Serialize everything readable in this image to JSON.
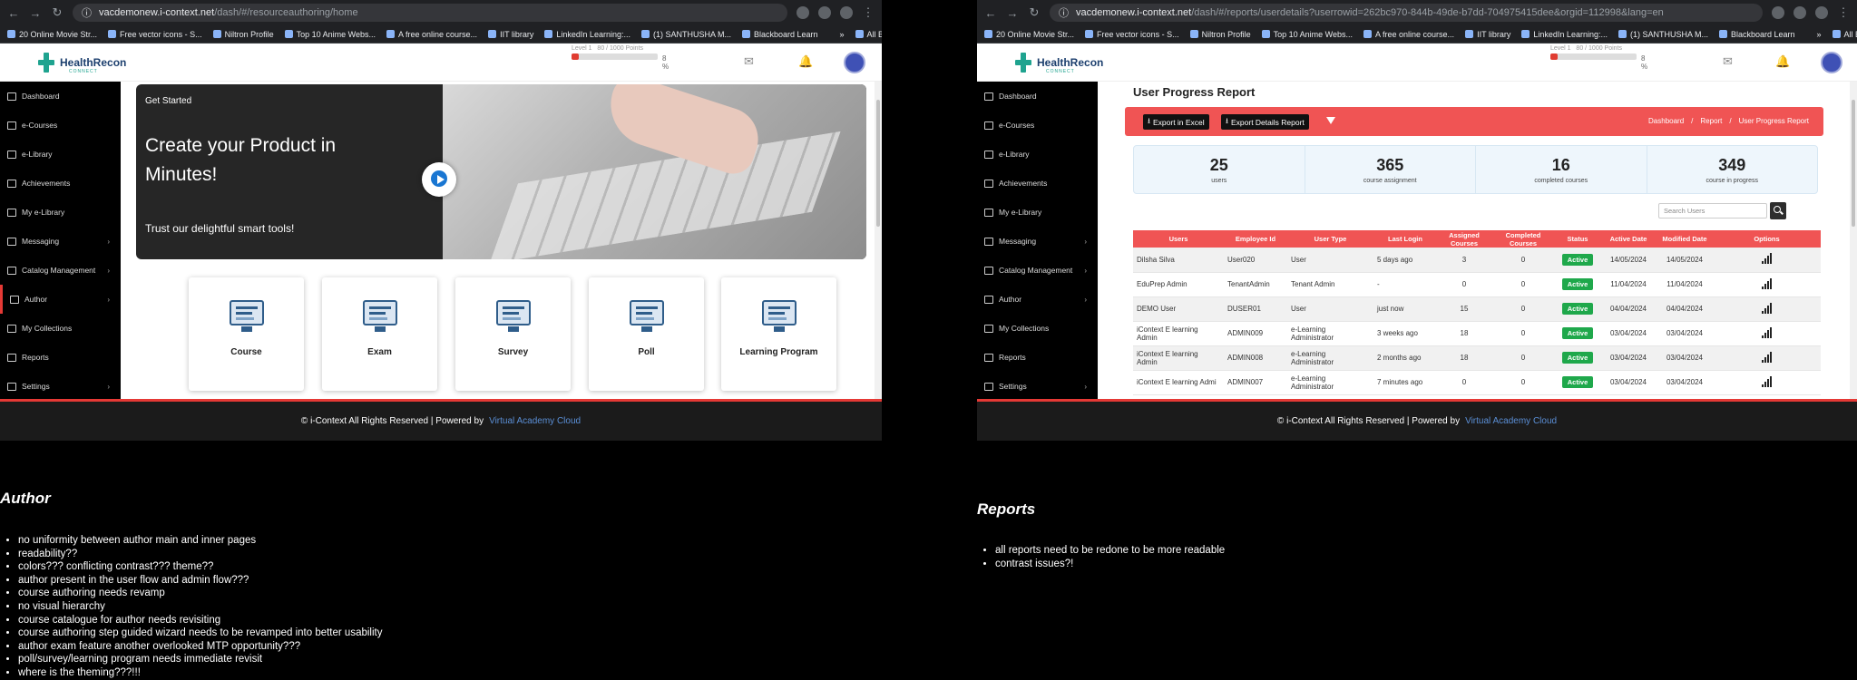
{
  "left": {
    "url_host": "vacdemonew.i-context.net",
    "url_path": "/dash/#/resourceauthoring/home",
    "bookmarks": [
      "20 Online Movie Str...",
      "Free vector icons - S...",
      "Niltron Profile",
      "Top 10 Anime Webs...",
      "A free online course...",
      "IIT library",
      "LinkedIn Learning:...",
      "(1) SANTHUSHA M...",
      "Blackboard Learn",
      "All Bookmarks"
    ],
    "logo": "HealthRecon",
    "logo_sub": "CONNECT",
    "level_label": "Level 1",
    "points_label": "80 / 1000 Points",
    "level_progress_pct": 8,
    "level_pct_text": "8 %",
    "sidebar": [
      "Dashboard",
      "e-Courses",
      "e-Library",
      "Achievements",
      "My e-Library",
      "Messaging",
      "Catalog Management",
      "Author",
      "My Collections",
      "Reports",
      "Settings"
    ],
    "hero": {
      "tag": "Get Started",
      "title": "Create your Product in Minutes!",
      "subtitle": "Trust our delightful smart tools!"
    },
    "cards": [
      "Course",
      "Exam",
      "Survey",
      "Poll",
      "Learning Program"
    ],
    "footer_text": "© i-Context All Rights Reserved | Powered by",
    "footer_link": "Virtual Academy Cloud"
  },
  "right": {
    "url_host": "vacdemonew.i-context.net",
    "url_path": "/dash/#/reports/userdetails?userrowid=262bc970-844b-49de-b7dd-704975415dee&orgid=112998&lang=en",
    "bookmarks": [
      "20 Online Movie Str...",
      "Free vector icons - S...",
      "Niltron Profile",
      "Top 10 Anime Webs...",
      "A free online course...",
      "IIT library",
      "LinkedIn Learning:...",
      "(1) SANTHUSHA M...",
      "Blackboard Learn",
      "All Bookmarks"
    ],
    "logo": "HealthRecon",
    "logo_sub": "CONNECT",
    "level_label": "Level 1",
    "points_label": "80 / 1000 Points",
    "level_progress_pct": 8,
    "level_pct_text": "8 %",
    "sidebar": [
      "Dashboard",
      "e-Courses",
      "e-Library",
      "Achievements",
      "My e-Library",
      "Messaging",
      "Catalog Management",
      "Author",
      "My Collections",
      "Reports",
      "Settings"
    ],
    "page_title": "User Progress Report",
    "export_excel": "Export in Excel",
    "export_details": "Export Details Report",
    "breadcrumb": [
      "Dashboard",
      "/",
      "Report",
      "/",
      "User Progress Report"
    ],
    "stats": [
      {
        "num": "25",
        "cap": "users"
      },
      {
        "num": "365",
        "cap": "course assignment"
      },
      {
        "num": "16",
        "cap": "completed courses"
      },
      {
        "num": "349",
        "cap": "course in progress"
      }
    ],
    "search_placeholder": "Search Users",
    "columns": [
      "Users",
      "Employee Id",
      "User Type",
      "Last Login",
      "Assigned Courses",
      "Completed Courses",
      "Status",
      "Active Date",
      "Modified Date",
      "Options"
    ],
    "rows": [
      [
        "Dilsha Silva",
        "User020",
        "User",
        "5 days ago",
        "3",
        "0",
        "Active",
        "14/05/2024",
        "14/05/2024"
      ],
      [
        "EduPrep Admin",
        "TenantAdmin",
        "Tenant Admin",
        "-",
        "0",
        "0",
        "Active",
        "11/04/2024",
        "11/04/2024"
      ],
      [
        "DEMO User",
        "DUSER01",
        "User",
        "just now",
        "15",
        "0",
        "Active",
        "04/04/2024",
        "04/04/2024"
      ],
      [
        "iContext E learning Admin",
        "ADMIN009",
        "e-Learning Administrator",
        "3 weeks ago",
        "18",
        "0",
        "Active",
        "03/04/2024",
        "03/04/2024"
      ],
      [
        "iContext E learning Admin",
        "ADMIN008",
        "e-Learning Administrator",
        "2 months ago",
        "18",
        "0",
        "Active",
        "03/04/2024",
        "03/04/2024"
      ],
      [
        "iContext E learning Admi",
        "ADMIN007",
        "e-Learning Administrator",
        "7 minutes ago",
        "0",
        "0",
        "Active",
        "03/04/2024",
        "03/04/2024"
      ]
    ],
    "footer_text": "© i-Context All Rights Reserved | Powered by",
    "footer_link": "Virtual Academy Cloud"
  },
  "notes": {
    "author_title": "Author",
    "author_items": [
      "no uniformity between author main and inner pages",
      "readability??",
      "colors??? conflicting contrast??? theme??",
      "author present in the user flow and admin flow???",
      "course authoring needs revamp",
      "no visual hierarchy",
      "course catalogue for author needs revisiting",
      "course authoring step guided wizard needs to be revamped into better usability",
      "author exam feature another overlooked MTP opportunity???",
      "poll/survey/learning program needs immediate revisit",
      "where is the theming???!!!"
    ],
    "reports_title": "Reports",
    "reports_items": [
      "all reports need to be redone to be more readable",
      "contrast issues?!"
    ]
  },
  "colors": {
    "accent_red": "#f05454",
    "status_green": "#1fa84b",
    "link_blue": "#5b8fd6",
    "sidebar_bg": "#000000"
  }
}
